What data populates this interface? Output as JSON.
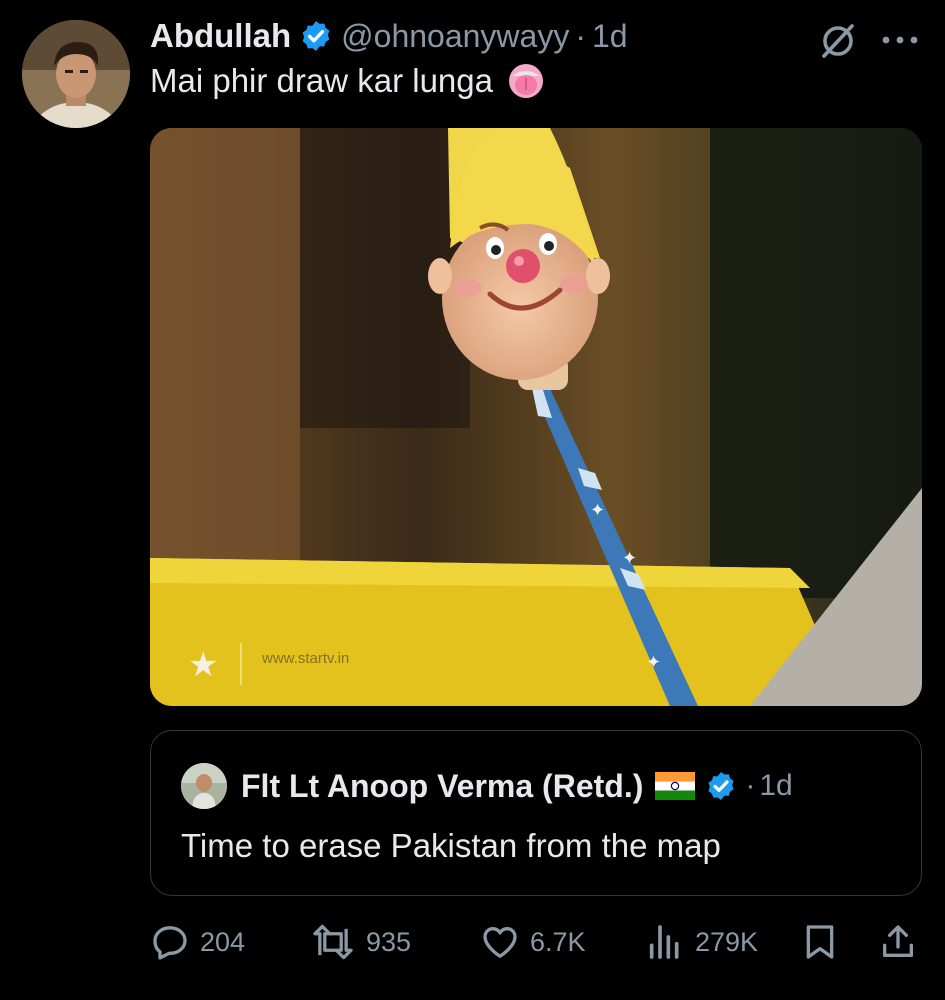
{
  "tweet": {
    "author_name": "Abdullah",
    "handle": "@ohnoanywayy",
    "separator": "·",
    "time": "1d",
    "text": "Mai phir draw kar lunga"
  },
  "media": {
    "watermark": "www.startv.in"
  },
  "quote": {
    "author_name": "Flt Lt Anoop Verma (Retd.)",
    "separator": "·",
    "time": "1d",
    "text": "Time to erase Pakistan from the map"
  },
  "actions": {
    "replies": "204",
    "reposts": "935",
    "likes": "6.7K",
    "views": "279K"
  },
  "icons": {
    "header": [
      "verified-badge-icon",
      "grok-icon",
      "more-icon",
      "tongue-emoji-icon"
    ],
    "quote": [
      "verified-badge-icon",
      "india-flag-icon"
    ],
    "actions": [
      "reply-icon",
      "repost-icon",
      "like-icon",
      "views-icon",
      "bookmark-icon",
      "share-icon"
    ]
  },
  "colors": {
    "background": "#000000",
    "text_primary": "#e7e9ea",
    "text_secondary": "#8b98a5",
    "verified": "#1d9bf0",
    "border": "#333639"
  }
}
